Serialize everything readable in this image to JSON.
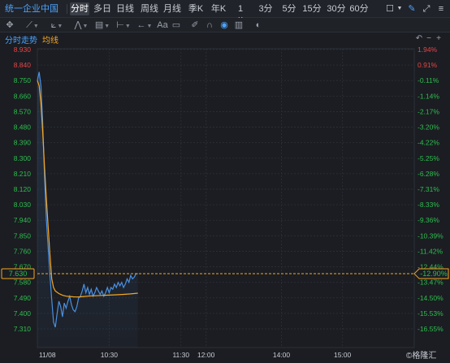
{
  "toolbar": {
    "stock_name": "统一企业中国",
    "tabs": [
      {
        "label": "分时",
        "active": true
      },
      {
        "label": "多日"
      },
      {
        "label": "日线"
      },
      {
        "label": "周线"
      },
      {
        "label": "月线"
      },
      {
        "label": "季K"
      },
      {
        "label": "年K"
      },
      {
        "label": "1分"
      },
      {
        "label": "3分"
      },
      {
        "label": "5分"
      },
      {
        "label": "15分"
      },
      {
        "label": "30分"
      },
      {
        "label": "60分"
      }
    ]
  },
  "drawing_tools": {
    "text_tool": "Aa"
  },
  "legend": {
    "price_line": "分时走势",
    "avg_line": "均线"
  },
  "colors": {
    "price_line": "#4a90e2",
    "avg_line": "#f5a623",
    "up": "#e84545",
    "down": "#2dbe4e",
    "flat": "#c8ccd4",
    "marker": "#f5a623"
  },
  "watermark": "©格隆汇",
  "chart_data": {
    "type": "line",
    "y_left_ticks": [
      "8.930",
      "8.840",
      "8.750",
      "8.660",
      "8.570",
      "8.480",
      "8.390",
      "8.300",
      "8.210",
      "8.120",
      "8.030",
      "7.940",
      "7.850",
      "7.760",
      "7.670",
      "7.580",
      "7.490",
      "7.400",
      "7.310"
    ],
    "y_right_ticks": [
      "1.94%",
      "0.91%",
      "-0.11%",
      "-1.14%",
      "-2.17%",
      "-3.20%",
      "-4.22%",
      "-5.25%",
      "-6.28%",
      "-7.31%",
      "-8.33%",
      "-9.36%",
      "-10.39%",
      "-11.42%",
      "-12.44%",
      "-13.47%",
      "-14.50%",
      "-15.53%",
      "-16.55%"
    ],
    "ylim": [
      7.31,
      8.93
    ],
    "reference_price": 8.76,
    "x_ticks": [
      "11/08",
      "10:30",
      "11:30",
      "12:00",
      "14:00",
      "15:00"
    ],
    "current_price": {
      "price": "7.630",
      "pct": "-12.90%",
      "value": 7.63
    },
    "series": [
      {
        "name": "分时走势",
        "points": [
          [
            0,
            8.75
          ],
          [
            0.5,
            8.8
          ],
          [
            1,
            8.72
          ],
          [
            1.5,
            8.5
          ],
          [
            2,
            8.2
          ],
          [
            2.5,
            7.95
          ],
          [
            3,
            7.78
          ],
          [
            3.5,
            7.62
          ],
          [
            4,
            7.48
          ],
          [
            4.5,
            7.35
          ],
          [
            5,
            7.32
          ],
          [
            5.5,
            7.4
          ],
          [
            6,
            7.47
          ],
          [
            6.5,
            7.44
          ],
          [
            7,
            7.38
          ],
          [
            7.5,
            7.46
          ],
          [
            8,
            7.43
          ],
          [
            8.5,
            7.47
          ],
          [
            9,
            7.5
          ],
          [
            9.5,
            7.45
          ],
          [
            10,
            7.42
          ],
          [
            10.5,
            7.41
          ],
          [
            11,
            7.44
          ],
          [
            11.5,
            7.49
          ],
          [
            12,
            7.5
          ],
          [
            12.5,
            7.53
          ],
          [
            13,
            7.57
          ],
          [
            13.5,
            7.52
          ],
          [
            14,
            7.55
          ],
          [
            14.5,
            7.51
          ],
          [
            15,
            7.54
          ],
          [
            15.5,
            7.5
          ],
          [
            16,
            7.52
          ],
          [
            16.5,
            7.55
          ],
          [
            17,
            7.53
          ],
          [
            17.5,
            7.51
          ],
          [
            18,
            7.53
          ],
          [
            18.5,
            7.5
          ],
          [
            19,
            7.52
          ],
          [
            19.5,
            7.55
          ],
          [
            20,
            7.52
          ],
          [
            20.5,
            7.55
          ],
          [
            21,
            7.54
          ],
          [
            21.5,
            7.57
          ],
          [
            22,
            7.55
          ],
          [
            22.5,
            7.58
          ],
          [
            23,
            7.56
          ],
          [
            23.5,
            7.58
          ],
          [
            24,
            7.55
          ],
          [
            24.5,
            7.57
          ],
          [
            25,
            7.6
          ],
          [
            25.5,
            7.58
          ],
          [
            26,
            7.62
          ],
          [
            26.5,
            7.6
          ],
          [
            27,
            7.61
          ],
          [
            27.5,
            7.63
          ],
          [
            28,
            7.63
          ]
        ]
      },
      {
        "name": "均线",
        "points": [
          [
            0,
            8.75
          ],
          [
            0.5,
            8.72
          ],
          [
            1,
            8.62
          ],
          [
            1.5,
            8.45
          ],
          [
            2,
            8.25
          ],
          [
            2.5,
            8.07
          ],
          [
            3,
            7.9
          ],
          [
            3.5,
            7.74
          ],
          [
            4,
            7.6
          ],
          [
            4.5,
            7.55
          ],
          [
            5,
            7.53
          ],
          [
            6,
            7.515
          ],
          [
            7,
            7.505
          ],
          [
            8,
            7.5
          ],
          [
            9,
            7.498
          ],
          [
            10,
            7.496
          ],
          [
            11,
            7.495
          ],
          [
            12,
            7.496
          ],
          [
            13,
            7.498
          ],
          [
            14,
            7.5
          ],
          [
            16,
            7.502
          ],
          [
            18,
            7.504
          ],
          [
            20,
            7.506
          ],
          [
            22,
            7.508
          ],
          [
            24,
            7.51
          ],
          [
            26,
            7.513
          ],
          [
            28,
            7.517
          ]
        ]
      }
    ],
    "x_tick_positions": {
      "11/08": 0,
      "10:30": 20,
      "11:30": 40,
      "12:00": 47,
      "14:00": 68,
      "15:00": 85
    },
    "x_max": 105
  }
}
